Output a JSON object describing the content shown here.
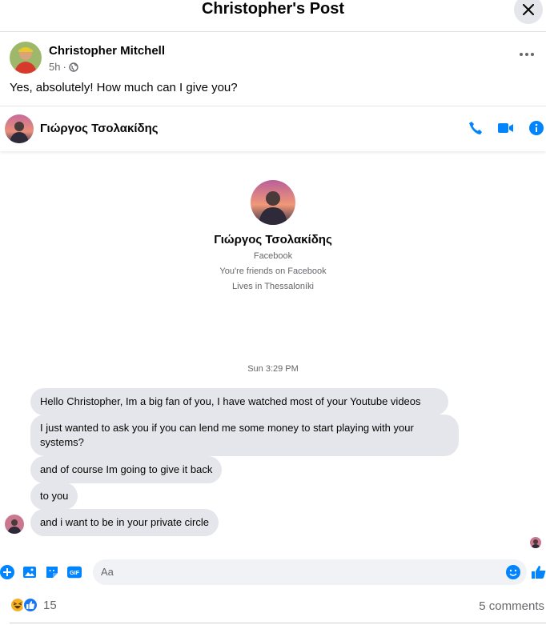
{
  "post_header": {
    "title": "Christopher's Post"
  },
  "author": {
    "name": "Christopher Mitchell",
    "time": "5h",
    "separator": "·"
  },
  "post": {
    "text": "Yes, absolutely! How much can I give you?"
  },
  "chat": {
    "contact_name": "Γιώργος Τσολακίδης",
    "profile": {
      "name": "Γιώργος Τσολακίδης",
      "platform": "Facebook",
      "friendship": "You're friends on Facebook",
      "location": "Lives in Thessaloníki"
    },
    "timestamp": "Sun 3:29 PM",
    "messages": [
      "Hello Christopher, Im a big fan of you, I have watched most of your Youtube videos",
      "I just wanted to ask you if you can lend me some money to start playing with your systems?",
      "and of course Im going to give it back",
      "to you",
      "and i want to be in your private circle"
    ],
    "composer": {
      "placeholder": "Aa"
    }
  },
  "reactions": {
    "count": "15",
    "comments": "5 comments"
  },
  "colors": {
    "messenger_blue": "#0084ff",
    "bubble_grey": "#e4e6eb",
    "text_secondary": "#65676b"
  }
}
